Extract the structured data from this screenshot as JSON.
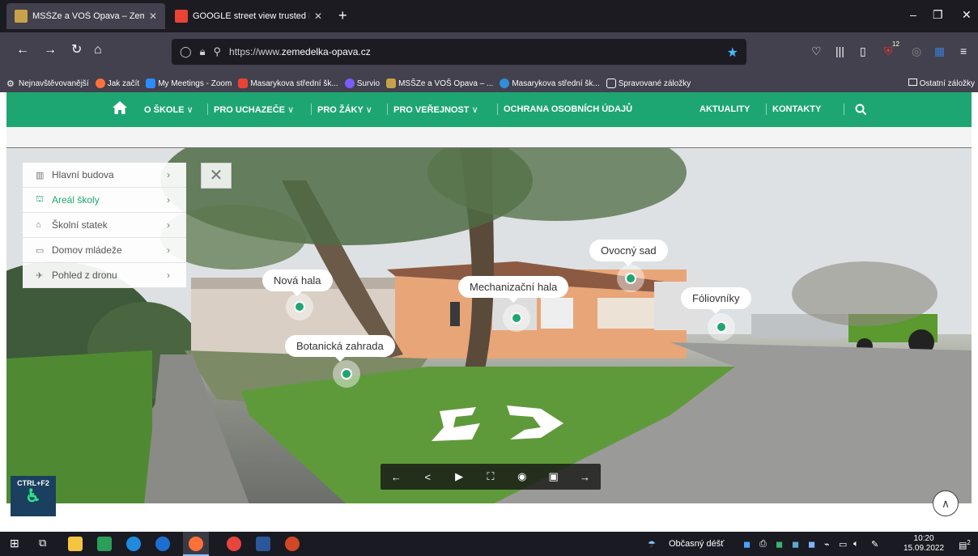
{
  "browser": {
    "tabs": [
      {
        "title": "MSŠZe a VOŠ Opava – Zeměděl",
        "close": "✕"
      },
      {
        "title": "GOOGLE street view trusted PA",
        "close": "✕"
      }
    ],
    "new_tab": "+",
    "window_controls": {
      "minimize": "–",
      "restore": "❐",
      "close": "✕"
    },
    "url_prefix": "https://www.",
    "url_domain": "zemedelka-opava.cz",
    "badge_count": "12"
  },
  "bookmarks": {
    "items": [
      "Nejnavštěvovanější",
      "Jak začít",
      "My Meetings - Zoom",
      "Masarykova střední šk...",
      "Survio",
      "MSŠZe a VOŠ Opava – ...",
      "Masarykova střední šk...",
      "Spravované záložky"
    ],
    "other": "Ostatní záložky"
  },
  "site_nav": {
    "items": [
      {
        "label": "O ŠKOLE",
        "caret": "∨"
      },
      {
        "label": "PRO UCHAZEČE",
        "caret": "∨"
      },
      {
        "label": "PRO ŽÁKY",
        "caret": "∨"
      },
      {
        "label": "PRO VEŘEJNOST",
        "caret": "∨"
      },
      {
        "label": "OCHRANA OSOBNÍCH ÚDAJŮ",
        "caret": ""
      },
      {
        "label": "AKTUALITY",
        "caret": ""
      },
      {
        "label": "KONTAKTY",
        "caret": ""
      }
    ]
  },
  "tour_menu": {
    "items": [
      {
        "label": "Hlavní budova",
        "icon": "▥"
      },
      {
        "label": "Areál školy",
        "icon": "⛫"
      },
      {
        "label": "Školní statek",
        "icon": "⌂"
      },
      {
        "label": "Domov mládeže",
        "icon": "▭"
      },
      {
        "label": "Pohled z dronu",
        "icon": "✈"
      }
    ],
    "chevron": "›",
    "close": "✕"
  },
  "hotspots": [
    {
      "label": "Nová hala"
    },
    {
      "label": "Mechanizační hala"
    },
    {
      "label": "Ovocný sad"
    },
    {
      "label": "Fóliovníky"
    },
    {
      "label": "Botanická zahrada"
    }
  ],
  "pano_controls": [
    "←",
    "<",
    "▶",
    "⛶",
    "◉",
    "▣",
    "→"
  ],
  "accessibility": {
    "shortcut": "CTRL+F2"
  },
  "taskbar": {
    "weather": "Občasný déšť",
    "time": "10:20",
    "date": "15.09.2022",
    "notifications": "2"
  },
  "colors": {
    "brand_green": "#1ea672",
    "browser_dark": "#1c1b22",
    "browser_mid": "#42414d",
    "accent_blue": "#44b9ff"
  }
}
